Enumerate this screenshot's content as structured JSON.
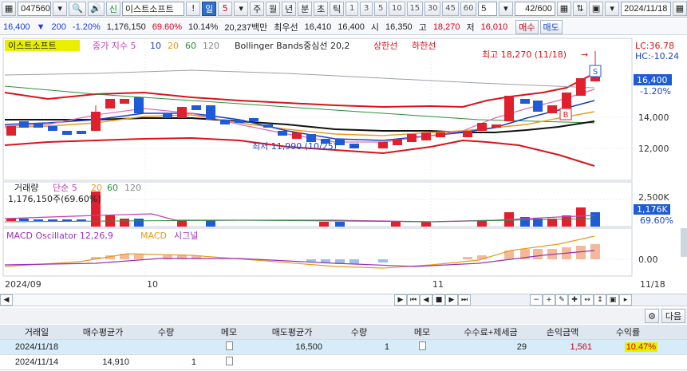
{
  "toolbar": {
    "code": "047560",
    "market_tag": "신",
    "stock_name": "이스트소프트",
    "period_value": "5",
    "periods": [
      "주",
      "월",
      "년",
      "분",
      "초",
      "틱"
    ],
    "day_label": "일",
    "nums": [
      "1",
      "3",
      "5",
      "10",
      "15",
      "30",
      "45",
      "60"
    ],
    "count_value": "5",
    "page_count": "42/600",
    "date": "2024/11/18"
  },
  "quote": {
    "price": "16,400",
    "change": "200",
    "change_pct": "-1.20%",
    "volume": "1,176,150",
    "vol_ratio": "69.60%",
    "turnover": "10.14%",
    "amount": "20,237백만",
    "sell_label": "최우선",
    "sell": "16,410",
    "buy": "16,400",
    "open_label": "시",
    "open": "16,350",
    "high_label": "고",
    "high": "18,270",
    "low_label": "저",
    "low": "16,010",
    "buy_btn": "매수",
    "sell_btn": "매도"
  },
  "price_panel": {
    "stock_label": "이스트소프트",
    "ma_label": "종가 지수 5",
    "ma_values": [
      "10",
      "20",
      "60",
      "120"
    ],
    "bb_label": "Bollinger Bands중심선 20,2",
    "upper_label": "상한선",
    "lower_label": "하한선",
    "lc": "LC:36.78",
    "hc": "HC:-10.24",
    "cur_price": "16,400",
    "cur_pct": "-1.20%",
    "axis": [
      "14,000",
      "12,000"
    ],
    "high_ann": "최고 18,270 (11/18)",
    "low_ann": "최저 11,990 (10/25)",
    "s_marker": "S",
    "b_marker": "B"
  },
  "volume_panel": {
    "label": "거래량",
    "ma_label": "단순 5",
    "ma_values": [
      "20",
      "60",
      "120"
    ],
    "vol_text": "1,176,150주(69.60%)",
    "axis": "2,500K",
    "cur_vol": "1,176K",
    "cur_pct": "69.60%"
  },
  "macd_panel": {
    "label": "MACD Oscillator 12,26,9",
    "macd": "MACD",
    "signal": "시그널",
    "axis": "0.00"
  },
  "x_axis": [
    "2024/09",
    "10",
    "11",
    "11/18"
  ],
  "bottom": {
    "next": "다음"
  },
  "table": {
    "headers": [
      "거래일",
      "매수평균가",
      "수량",
      "메모",
      "매도평균가",
      "수량",
      "메모",
      "수수료+제세금",
      "손익금액",
      "수익률"
    ],
    "rows": [
      [
        "2024/11/18",
        "",
        "",
        "",
        "16,500",
        "1",
        "",
        "29",
        "1,561",
        "10.47%"
      ],
      [
        "2024/11/14",
        "14,910",
        "1",
        "",
        "",
        "",
        "",
        "",
        "",
        ""
      ]
    ]
  },
  "colors": {
    "up": "#e0202c",
    "down": "#1e5bd6",
    "highlight": "#e8f000"
  }
}
